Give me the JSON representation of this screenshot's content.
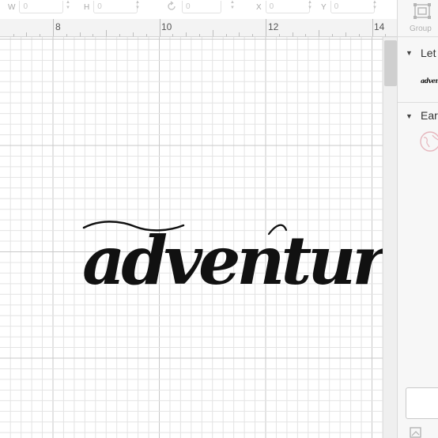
{
  "toolbar": {
    "w_label": "W",
    "w_value": "0",
    "h_label": "H",
    "h_value": "0",
    "rotate_value": "0",
    "x_label": "X",
    "x_value": "0",
    "y_label": "Y",
    "y_value": "0"
  },
  "ruler": {
    "labels": [
      "8",
      "10",
      "12",
      "14"
    ]
  },
  "canvas": {
    "design_text": "adventure"
  },
  "panel": {
    "group_label": "Group",
    "layer_1_title": "Let",
    "layer_1_thumb_text": "adventure",
    "layer_2_title": "Ear"
  },
  "icons": {
    "group": "group-icon",
    "rotate": "rotate-icon",
    "collapse": "caret-down-icon",
    "earth": "earth-icon",
    "canvas_settings": "canvas-icon"
  }
}
